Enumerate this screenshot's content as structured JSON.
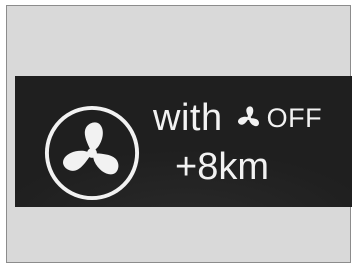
{
  "panel": {
    "with_label": "with",
    "off_label": "OFF",
    "range_gain": "+8km",
    "icons": {
      "main": "fan-icon",
      "inline": "fan-off-icon"
    },
    "colors": {
      "background": "#1f1f1f",
      "foreground": "#f2f2f2"
    }
  }
}
